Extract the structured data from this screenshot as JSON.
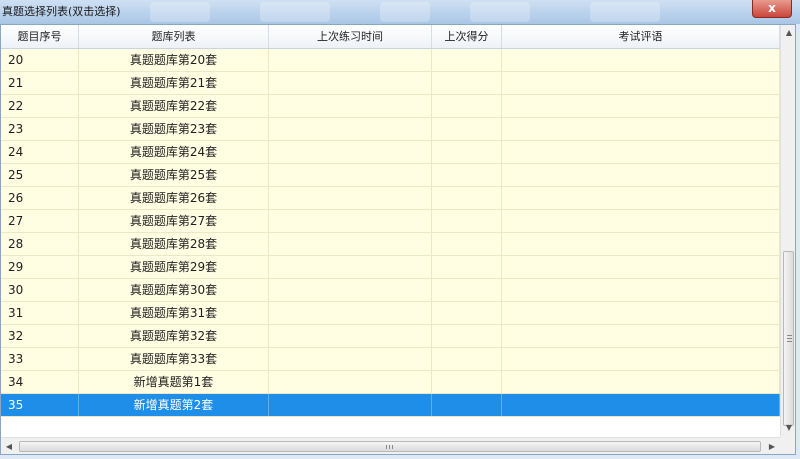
{
  "window": {
    "title": "真题选择列表(双击选择)",
    "close_glyph": "x"
  },
  "columns": [
    "题目序号",
    "题库列表",
    "上次练习时间",
    "上次得分",
    "考试评语"
  ],
  "rows": [
    {
      "id": "20",
      "name": "真题题库第20套",
      "last_time": "",
      "score": "",
      "comment": ""
    },
    {
      "id": "21",
      "name": "真题题库第21套",
      "last_time": "",
      "score": "",
      "comment": ""
    },
    {
      "id": "22",
      "name": "真题题库第22套",
      "last_time": "",
      "score": "",
      "comment": ""
    },
    {
      "id": "23",
      "name": "真题题库第23套",
      "last_time": "",
      "score": "",
      "comment": ""
    },
    {
      "id": "24",
      "name": "真题题库第24套",
      "last_time": "",
      "score": "",
      "comment": ""
    },
    {
      "id": "25",
      "name": "真题题库第25套",
      "last_time": "",
      "score": "",
      "comment": ""
    },
    {
      "id": "26",
      "name": "真题题库第26套",
      "last_time": "",
      "score": "",
      "comment": ""
    },
    {
      "id": "27",
      "name": "真题题库第27套",
      "last_time": "",
      "score": "",
      "comment": ""
    },
    {
      "id": "28",
      "name": "真题题库第28套",
      "last_time": "",
      "score": "",
      "comment": ""
    },
    {
      "id": "29",
      "name": "真题题库第29套",
      "last_time": "",
      "score": "",
      "comment": ""
    },
    {
      "id": "30",
      "name": "真题题库第30套",
      "last_time": "",
      "score": "",
      "comment": ""
    },
    {
      "id": "31",
      "name": "真题题库第31套",
      "last_time": "",
      "score": "",
      "comment": ""
    },
    {
      "id": "32",
      "name": "真题题库第32套",
      "last_time": "",
      "score": "",
      "comment": ""
    },
    {
      "id": "33",
      "name": "真题题库第33套",
      "last_time": "",
      "score": "",
      "comment": ""
    },
    {
      "id": "34",
      "name": "新增真题第1套",
      "last_time": "",
      "score": "",
      "comment": ""
    },
    {
      "id": "35",
      "name": "新增真题第2套",
      "last_time": "",
      "score": "",
      "comment": "",
      "selected": true
    }
  ],
  "colors": {
    "row_background": "#fffde2",
    "selected_background": "#1e8ee8",
    "titlebar": "#a9c6e6"
  },
  "icons": {
    "close": "close-icon",
    "scroll_up": "arrow-up-icon",
    "scroll_down": "arrow-down-icon",
    "scroll_left": "arrow-left-icon",
    "scroll_right": "arrow-right-icon"
  }
}
